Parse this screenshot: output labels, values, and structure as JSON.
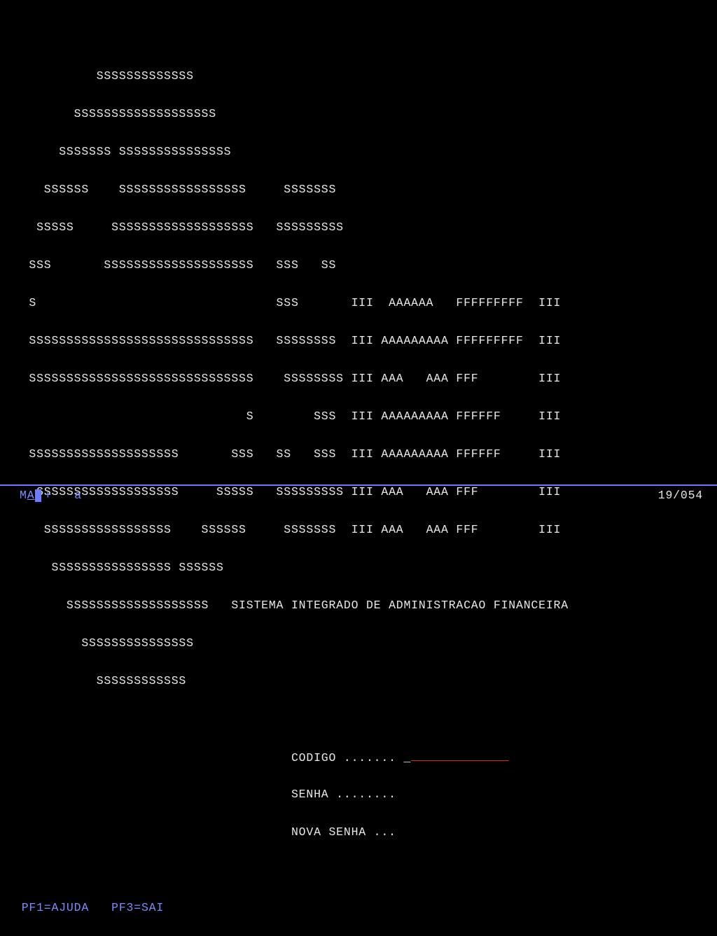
{
  "art": [
    "           SSSSSSSSSSSSS",
    "        SSSSSSSSSSSSSSSSSSS",
    "      SSSSSSS SSSSSSSSSSSSSSS",
    "    SSSSSS    SSSSSSSSSSSSSSSSS     SSSSSSS",
    "   SSSSS     SSSSSSSSSSSSSSSSSSS   SSSSSSSSS",
    "  SSS       SSSSSSSSSSSSSSSSSSSS   SSS   SS",
    "  S                                SSS       III  AAAAAA   FFFFFFFFF  III",
    "  SSSSSSSSSSSSSSSSSSSSSSSSSSSSSS   SSSSSSSS  III AAAAAAAAA FFFFFFFFF  III",
    "  SSSSSSSSSSSSSSSSSSSSSSSSSSSSSS    SSSSSSSS III AAA   AAA FFF        III",
    "                               S        SSS  III AAAAAAAAA FFFFFF     III",
    "  SSSSSSSSSSSSSSSSSSSS       SSS   SS   SSS  III AAAAAAAAA FFFFFF     III",
    "   SSSSSSSSSSSSSSSSSSS     SSSSS   SSSSSSSSS III AAA   AAA FFF        III",
    "    SSSSSSSSSSSSSSSSS    SSSSSS     SSSSSSS  III AAA   AAA FFF        III",
    "     SSSSSSSSSSSSSSSS SSSSSS",
    "       SSSSSSSSSSSSSSSSSSS   SISTEMA INTEGRADO DE ADMINISTRACAO FINANCEIRA",
    "         SSSSSSSSSSSSSSS",
    "           SSSSSSSSSSSS"
  ],
  "system_title": "SISTEMA INTEGRADO DE ADMINISTRACAO FINANCEIRA",
  "fields": {
    "codigo_label": "CODIGO .......",
    "senha_label": "SENHA ........",
    "nova_senha_label": "NOVA SENHA ...",
    "codigo_value": "",
    "senha_value": "",
    "nova_senha_value": ""
  },
  "fkeys": {
    "pf1": "PF1=AJUDA",
    "pf3": "PF3=SAI"
  },
  "status": {
    "left_ma": "MA",
    "left_plus": "+",
    "left_a": "a",
    "pos": "19/054"
  }
}
